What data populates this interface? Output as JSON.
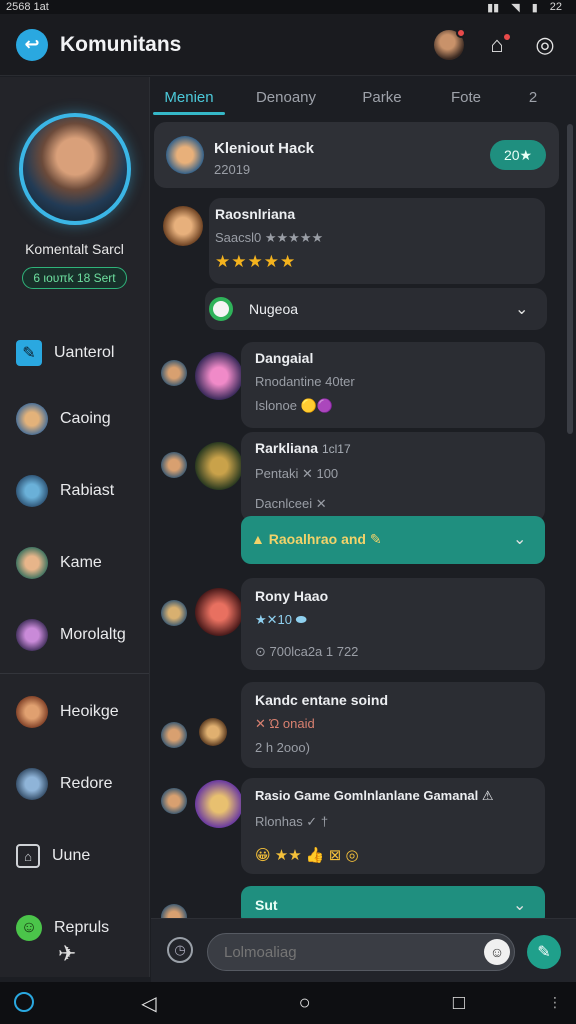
{
  "status_bar": {
    "time": "2568 1at",
    "icons": [
      "signal-icon",
      "wifi-icon",
      "battery-icon"
    ],
    "right_text": "22"
  },
  "app": {
    "title": "Komunitans",
    "accent": "#2aa8e0"
  },
  "profile": {
    "name": "Komentalt Sarcl",
    "status": "6 ιουπk 18 Sert"
  },
  "sidebar": {
    "items": [
      {
        "label": "Uanterol",
        "icon": "pen-icon"
      },
      {
        "label": "Caoing",
        "icon": "avatar-icon"
      },
      {
        "label": "Rabiast",
        "icon": "avatar-icon"
      },
      {
        "label": "Kame",
        "icon": "avatar-icon"
      },
      {
        "label": "Morolaltg",
        "icon": "avatar-icon"
      },
      {
        "label": "Heoikge",
        "icon": "avatar-icon"
      },
      {
        "label": "Redore",
        "icon": "avatar-icon"
      },
      {
        "label": "Uune",
        "icon": "home-icon"
      },
      {
        "label": "Repruls",
        "icon": "smile-icon"
      }
    ]
  },
  "tabs": [
    {
      "label": "Menien",
      "active": true
    },
    {
      "label": "Denoany",
      "active": false
    },
    {
      "label": "Parke",
      "active": false
    },
    {
      "label": "Fote",
      "active": false
    },
    {
      "label": "2",
      "active": false
    }
  ],
  "feed": {
    "pinned": {
      "title": "Kleniout Hack",
      "sub": "22019",
      "badge": "20★"
    },
    "post1": {
      "title": "Raosnlriana",
      "sub": "Saacsl0 ★★★★★",
      "stars": "★★★★★",
      "rating": 5
    },
    "dropdown1": {
      "label": "Nugeoa"
    },
    "post2": {
      "title": "Dangaial",
      "sub": "Rnodantine 40ter",
      "meta": "Islonoe 🟡🟣"
    },
    "post3": {
      "title": "Rarkliana",
      "title_extra": "1cl17",
      "sub": "Pentaki ✕ 100",
      "meta": "Dacnlceei ✕",
      "bar_label": "▲ Raoalhrao and ✎"
    },
    "post4": {
      "title": "Rony Haao",
      "sub": "★✕10 ⬬",
      "meta": "⊙ 700lca2a 1 722"
    },
    "post5": {
      "title": "Kandc entane soind",
      "sub": "✕ Ώ onaid",
      "meta": "2 h 2ooo)"
    },
    "post6": {
      "title": "Rasio Game Gomlnlanlane Gamanal ⚠",
      "sub": "Rlonhas ✓ †",
      "meta": "😀 ★★ 👍 ⊠ ◎"
    },
    "bottom_bar": {
      "label": "Sut"
    }
  },
  "input": {
    "placeholder": "Lolmoaliag"
  }
}
